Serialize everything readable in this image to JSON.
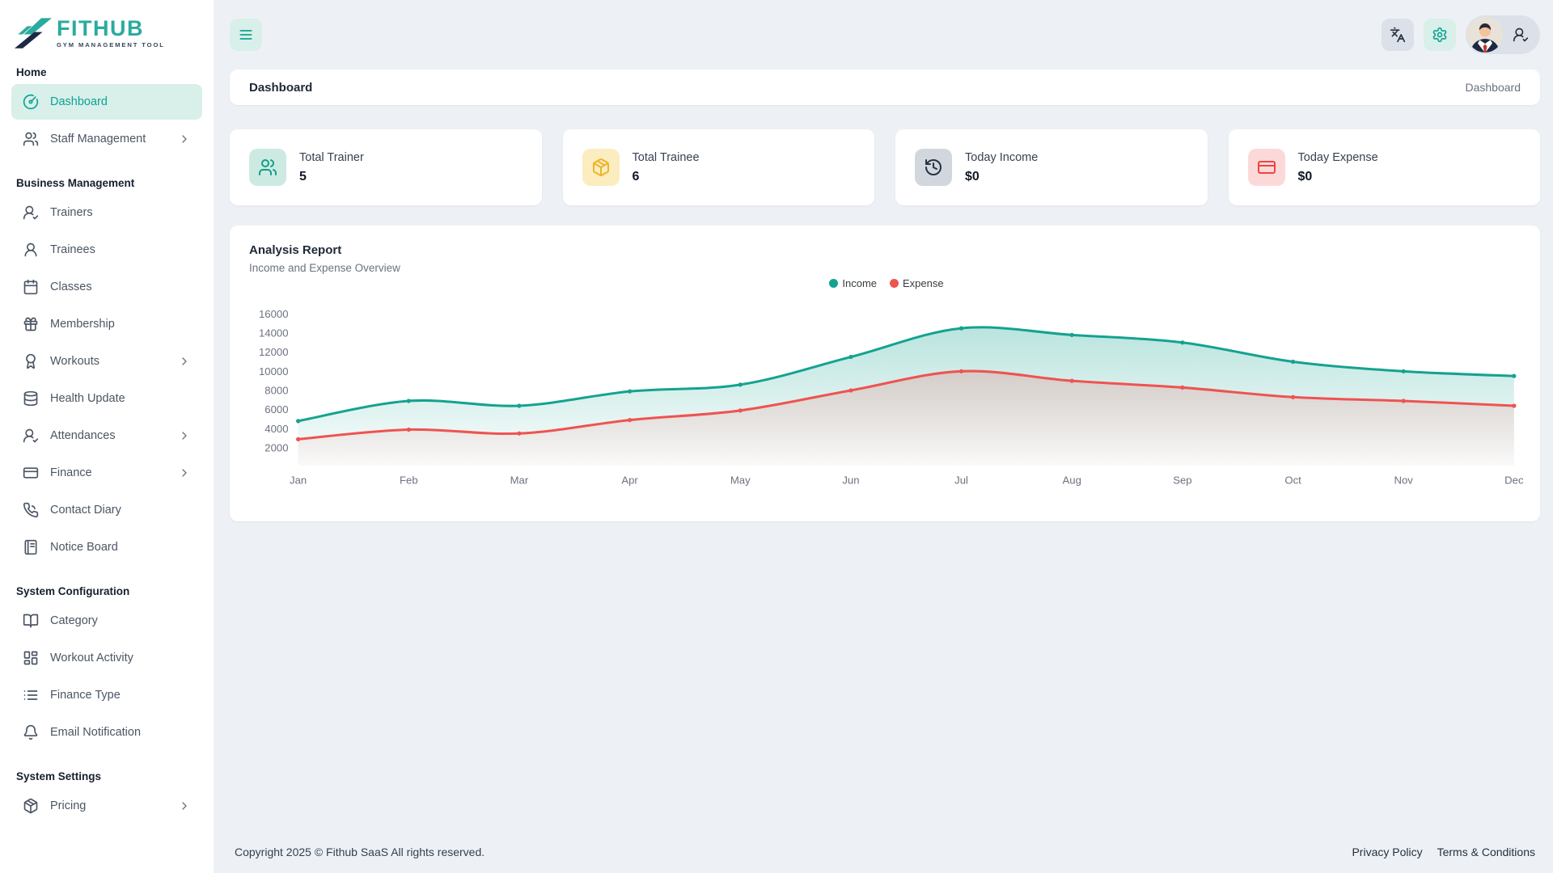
{
  "brand": {
    "name": "FITHUB",
    "tagline": "GYM MANAGEMENT TOOL",
    "colors": {
      "teal": "#2aab9d",
      "navy": "#1e2947"
    }
  },
  "topbar": {
    "menu_button_icon": "menu-icon",
    "language_button_icon": "languages-icon",
    "settings_button_icon": "gear-icon",
    "profile_icon": "user-check-icon"
  },
  "page_header": {
    "title": "Dashboard",
    "breadcrumb": "Dashboard"
  },
  "sidebar": {
    "sections": [
      {
        "label": "Home",
        "items": [
          {
            "label": "Dashboard",
            "icon": "gauge-icon",
            "active": true
          },
          {
            "label": "Staff Management",
            "icon": "users-icon",
            "chevron": true
          }
        ]
      },
      {
        "label": "Business Management",
        "items": [
          {
            "label": "Trainers",
            "icon": "user-check-icon"
          },
          {
            "label": "Trainees",
            "icon": "user-icon"
          },
          {
            "label": "Classes",
            "icon": "calendar-icon"
          },
          {
            "label": "Membership",
            "icon": "gift-icon"
          },
          {
            "label": "Workouts",
            "icon": "award-icon",
            "chevron": true
          },
          {
            "label": "Health Update",
            "icon": "database-icon"
          },
          {
            "label": "Attendances",
            "icon": "user-check-icon",
            "chevron": true
          },
          {
            "label": "Finance",
            "icon": "credit-card-icon",
            "chevron": true
          },
          {
            "label": "Contact Diary",
            "icon": "phone-icon"
          },
          {
            "label": "Notice Board",
            "icon": "notebook-icon"
          }
        ]
      },
      {
        "label": "System Configuration",
        "items": [
          {
            "label": "Category",
            "icon": "book-open-icon"
          },
          {
            "label": "Workout Activity",
            "icon": "layout-grid-icon"
          },
          {
            "label": "Finance Type",
            "icon": "list-icon"
          },
          {
            "label": "Email Notification",
            "icon": "bell-icon"
          }
        ]
      },
      {
        "label": "System Settings",
        "items": [
          {
            "label": "Pricing",
            "icon": "package-icon",
            "chevron": true
          }
        ]
      }
    ]
  },
  "stats": [
    {
      "label": "Total Trainer",
      "value": "5",
      "icon": "users-icon",
      "accent": "teal"
    },
    {
      "label": "Total Trainee",
      "value": "6",
      "icon": "package-icon",
      "accent": "amber"
    },
    {
      "label": "Today Income",
      "value": "$0",
      "icon": "history-icon",
      "accent": "gray"
    },
    {
      "label": "Today Expense",
      "value": "$0",
      "icon": "credit-card-icon",
      "accent": "red"
    }
  ],
  "analysis": {
    "title": "Analysis Report",
    "subtitle": "Income and Expense Overview"
  },
  "chart_data": {
    "type": "area",
    "categories": [
      "Jan",
      "Feb",
      "Mar",
      "Apr",
      "May",
      "Jun",
      "Jul",
      "Aug",
      "Sep",
      "Oct",
      "Nov",
      "Dec"
    ],
    "series": [
      {
        "name": "Income",
        "color": "#14a38f",
        "values": [
          4800,
          6900,
          6400,
          7900,
          8600,
          11500,
          14500,
          13800,
          13000,
          11000,
          10000,
          9500
        ]
      },
      {
        "name": "Expense",
        "color": "#ef5350",
        "values": [
          2900,
          3900,
          3500,
          4900,
          5900,
          8000,
          10000,
          9000,
          8300,
          7300,
          6900,
          6400
        ]
      }
    ],
    "ylim": [
      2000,
      16000
    ],
    "yticks": [
      16000,
      14000,
      12000,
      10000,
      8000,
      6000,
      4000,
      2000
    ],
    "grid": false,
    "legend_position": "top-center"
  },
  "footer": {
    "copyright": "Copyright 2025 © Fithub SaaS All rights reserved.",
    "links": [
      {
        "label": "Privacy Policy"
      },
      {
        "label": "Terms & Conditions"
      }
    ]
  }
}
